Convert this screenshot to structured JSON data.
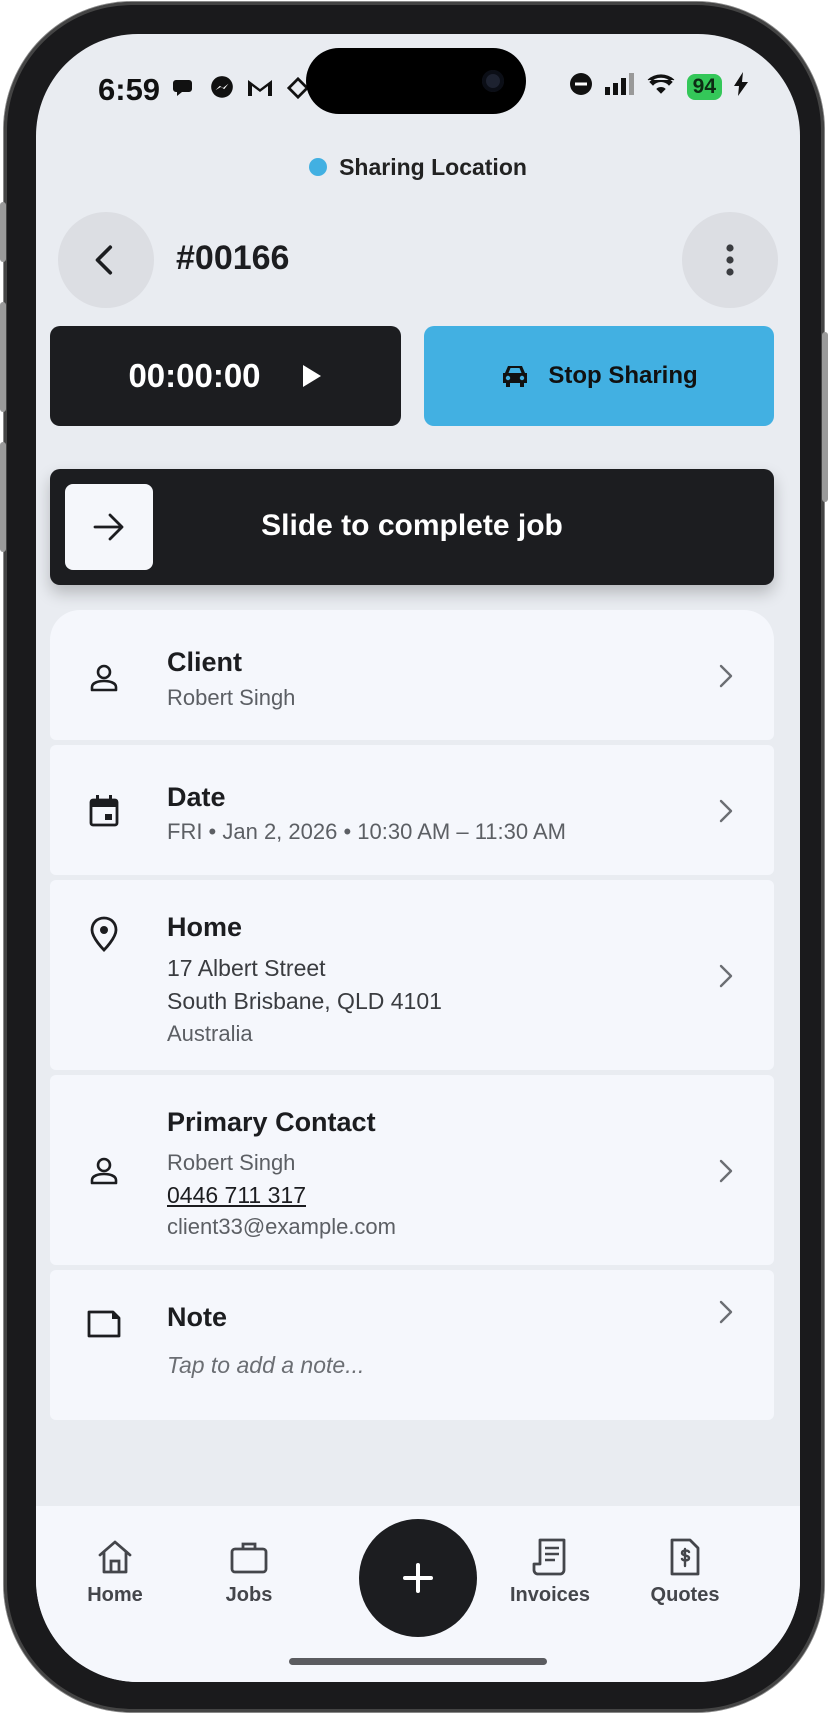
{
  "status_bar": {
    "time": "6:59",
    "battery": "94"
  },
  "sharing": {
    "indicator_text": "Sharing Location",
    "indicator_color": "#42b0e2"
  },
  "header": {
    "job_number": "#00166"
  },
  "actions": {
    "timer": "00:00:00",
    "stop_sharing_label": "Stop Sharing"
  },
  "slider": {
    "label": "Slide to complete job"
  },
  "client": {
    "title": "Client",
    "name": "Robert Singh"
  },
  "date": {
    "title": "Date",
    "value": "FRI • Jan 2, 2026 • 10:30 AM – 11:30 AM"
  },
  "location": {
    "title": "Home",
    "line1": "17 Albert Street",
    "line2": "South Brisbane, QLD 4101",
    "country": "Australia"
  },
  "contact": {
    "title": "Primary Contact",
    "name": "Robert Singh",
    "phone": "0446 711 317",
    "email": "client33@example.com"
  },
  "note": {
    "title": "Note",
    "placeholder": "Tap to add a note..."
  },
  "nav": {
    "home": "Home",
    "jobs": "Jobs",
    "invoices": "Invoices",
    "quotes": "Quotes"
  },
  "colors": {
    "accent": "#42b0e2",
    "dark": "#1c1d20",
    "background": "#e9ecf1",
    "card": "#f5f7fc"
  }
}
